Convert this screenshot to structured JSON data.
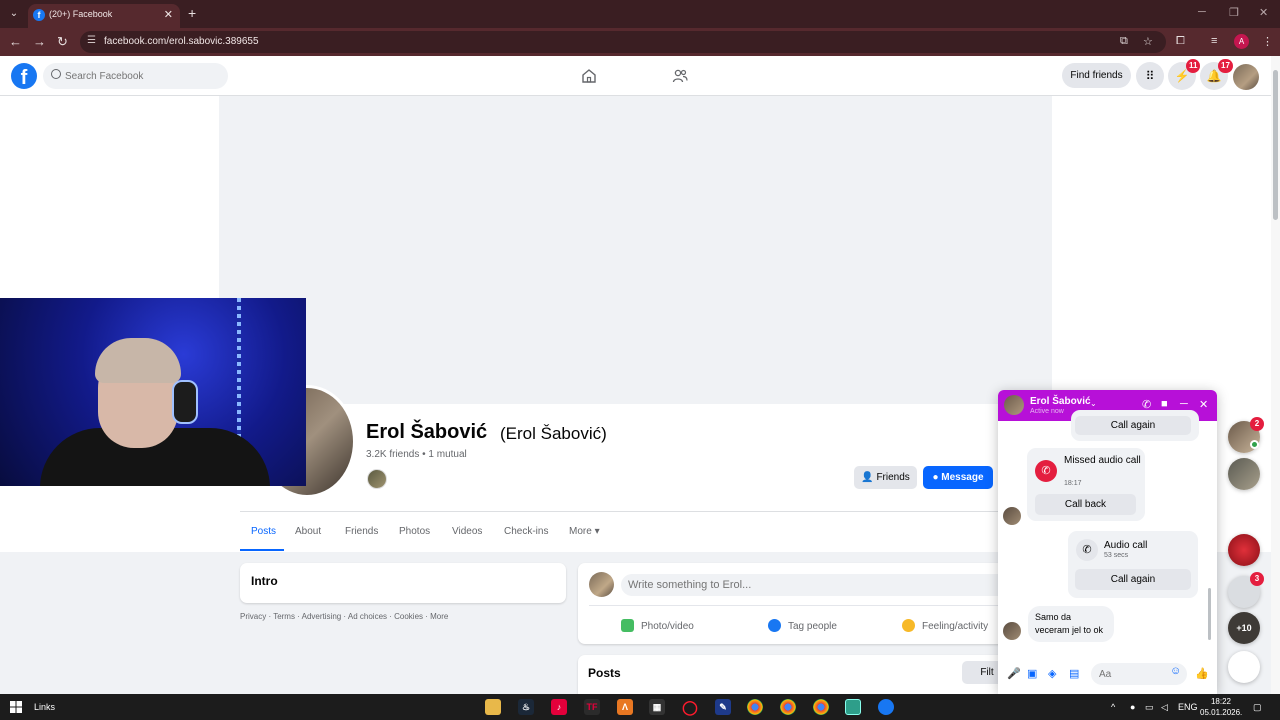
{
  "browser": {
    "tab_title": "(20+) Facebook",
    "tab_favicon": "f",
    "url": "facebook.com/erol.sabovic.389655",
    "profile_initial": "A"
  },
  "fb": {
    "logo_letter": "f",
    "search_placeholder": "Search Facebook",
    "find_friends": "Find friends",
    "messenger_badge": "11",
    "notifications_badge": "17"
  },
  "profile": {
    "name": "Erol Šabović",
    "alt_name": "(Erol Šabović)",
    "meta": "3.2K friends • 1 mutual",
    "friends_button": "Friends",
    "message_button": "Message",
    "tabs": [
      "Posts",
      "About",
      "Friends",
      "Photos",
      "Videos",
      "Check-ins",
      "More"
    ],
    "intro_title": "Intro",
    "footer": "Privacy · Terms · Advertising · Ad choices     · Cookies · More",
    "composer_placeholder": "Write something to Erol...",
    "actions": [
      "Photo/video",
      "Tag people",
      "Feeling/activity"
    ],
    "posts_title": "Posts",
    "filters_label": "Filt"
  },
  "chat": {
    "name": "Erol Šabović",
    "status": "Active now",
    "top_button": "Call again",
    "missed_title": "Missed audio call",
    "missed_time": "18:17",
    "call_back": "Call back",
    "audio_title": "Audio call",
    "audio_duration": "53 secs",
    "call_again": "Call again",
    "text_message": "Samo da veceram jel to ok",
    "input_placeholder": "Aa"
  },
  "side_contacts": {
    "badge_1": "2",
    "badge_2": "3",
    "more_label": "+10"
  },
  "taskbar": {
    "links_label": "Links",
    "lang": "ENG",
    "time": "18:22",
    "date": "05.01.2026."
  },
  "colors": {
    "fb_blue": "#0866ff",
    "chat_header": "#b710d8",
    "badge_red": "#e41e3f",
    "chrome_frame": "#56292e"
  }
}
